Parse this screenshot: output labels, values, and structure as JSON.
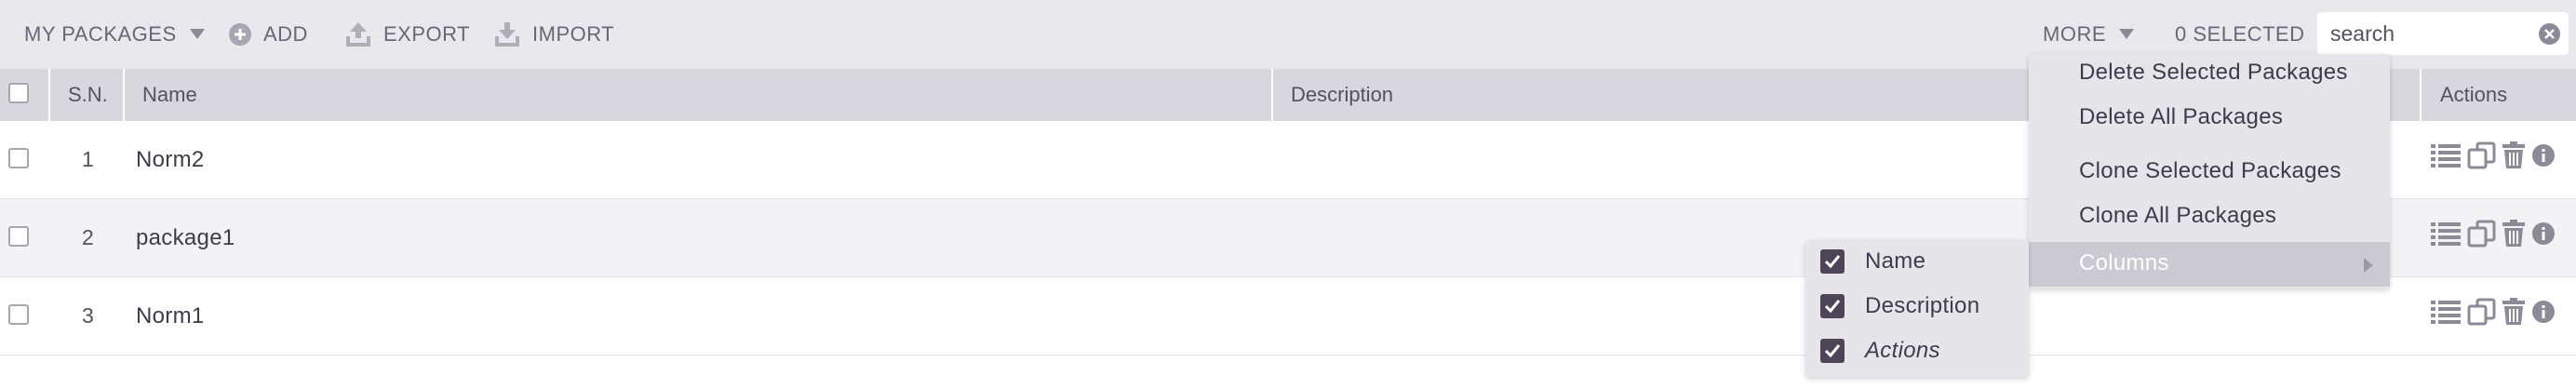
{
  "toolbar": {
    "my_packages": "MY PACKAGES",
    "add": "ADD",
    "export": "EXPORT",
    "import": "IMPORT",
    "more": "MORE",
    "selected": "0 SELECTED",
    "search_placeholder": "search"
  },
  "table": {
    "headers": {
      "sn": "S.N.",
      "name": "Name",
      "description": "Description",
      "actions": "Actions"
    },
    "rows": [
      {
        "sn": "1",
        "name": "Norm2",
        "description": ""
      },
      {
        "sn": "2",
        "name": "package1",
        "description": ""
      },
      {
        "sn": "3",
        "name": "Norm1",
        "description": ""
      }
    ]
  },
  "more_menu": {
    "items": [
      "Delete Selected Packages",
      "Delete All Packages",
      "Clone Selected Packages",
      "Clone All Packages",
      "Columns"
    ]
  },
  "columns_menu": {
    "items": [
      {
        "label": "Name",
        "checked": true
      },
      {
        "label": "Description",
        "checked": true
      },
      {
        "label": "Actions",
        "checked": true
      }
    ]
  },
  "colors": {
    "toolbar_bg": "#e9e8ed",
    "header_bg": "#d8d7de",
    "menu_bg": "#e6e5ea",
    "menu_highlight": "#cbcad3",
    "icon": "#8d8a98",
    "text": "#3f3b4d"
  },
  "icons": [
    "chevron-down-icon",
    "plus-circle-icon",
    "upload-icon",
    "download-icon",
    "clear-icon",
    "list-icon",
    "clone-icon",
    "trash-icon",
    "info-icon",
    "check-icon",
    "chevron-right-icon"
  ]
}
